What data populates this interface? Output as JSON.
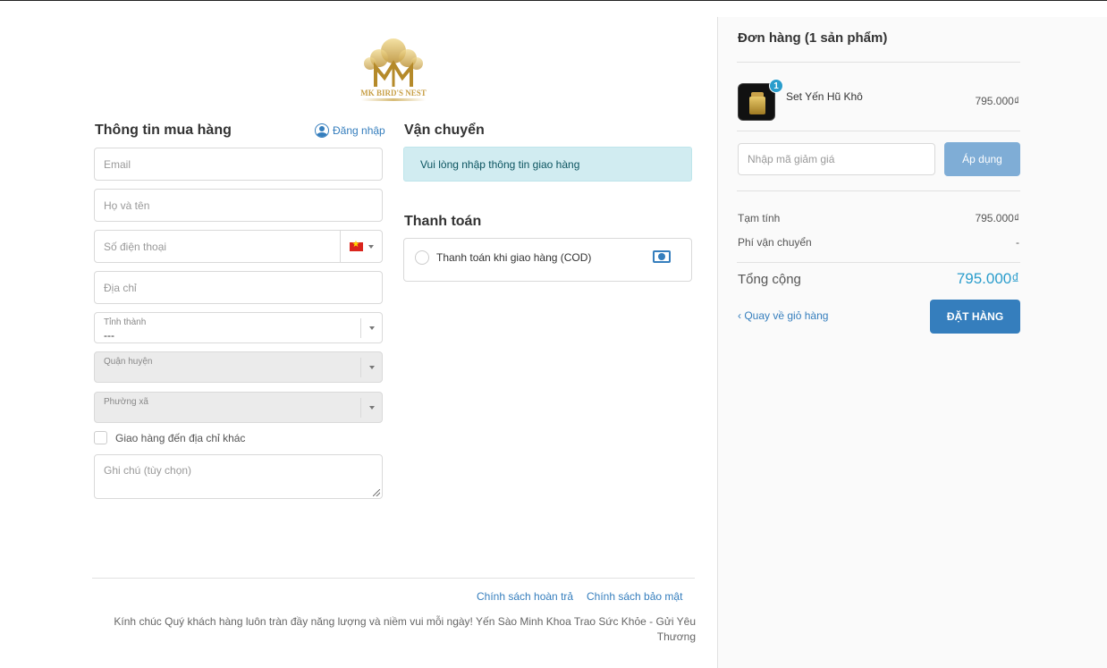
{
  "logo": {
    "alt_text": "MK BIRD'S NEST"
  },
  "buyer": {
    "title": "Thông tin mua hàng",
    "login_label": "Đăng nhập",
    "email_placeholder": "Email",
    "name_placeholder": "Họ và tên",
    "phone_placeholder": "Số điện thoại",
    "address_placeholder": "Địa chỉ",
    "province": {
      "label": "Tỉnh thành",
      "value": "---"
    },
    "district": {
      "label": "Quận huyện"
    },
    "ward": {
      "label": "Phường xã"
    },
    "other_address_label": "Giao hàng đến địa chỉ khác",
    "note_placeholder": "Ghi chú (tùy chọn)"
  },
  "shipping": {
    "title": "Vận chuyển",
    "message": "Vui lòng nhập thông tin giao hàng"
  },
  "payment": {
    "title": "Thanh toán",
    "option_label": "Thanh toán khi giao hàng (COD)"
  },
  "footer": {
    "refund_policy": "Chính sách hoàn trả",
    "privacy_policy": "Chính sách bảo mật",
    "note": "Kính chúc Quý khách hàng luôn tràn đầy năng lượng và niềm vui mỗi ngày! Yến Sào Minh Khoa Trao Sức Khỏe - Gửi Yêu Thương"
  },
  "order": {
    "title": "Đơn hàng (1 sản phẩm)",
    "item": {
      "name": "Set Yến Hũ Khô",
      "price": "795.000₫",
      "quantity": "1"
    },
    "discount_placeholder": "Nhập mã giảm giá",
    "apply_label": "Áp dụng",
    "subtotal_label": "Tạm tính",
    "subtotal_value": "795.000₫",
    "shipping_fee_label": "Phí vận chuyển",
    "shipping_fee_value": "-",
    "total_label": "Tổng cộng",
    "total_value": "795.000₫",
    "back_label": "Quay về giỏ hàng",
    "submit_label": "ĐẶT HÀNG"
  },
  "colors": {
    "accent": "#357ebd",
    "total": "#2a9dcc",
    "info_bg": "#d1ecf1",
    "logo_gold": "#c8a048"
  }
}
